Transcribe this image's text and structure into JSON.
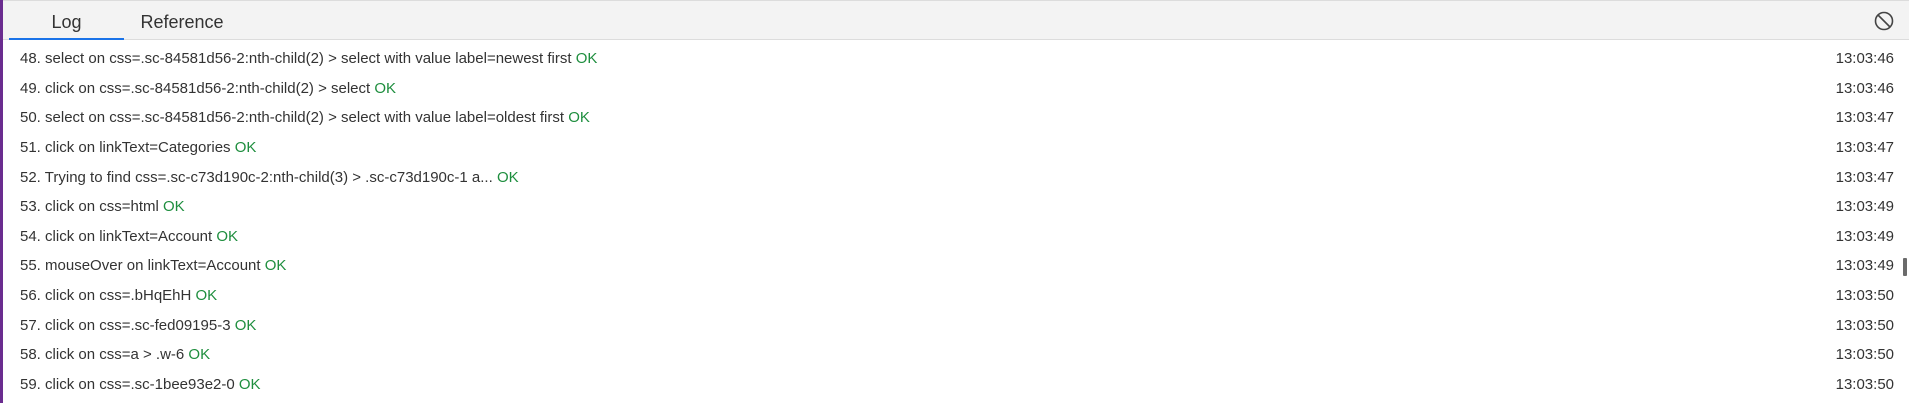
{
  "tabs": [
    {
      "label": "Log",
      "active": true
    },
    {
      "label": "Reference",
      "active": false
    }
  ],
  "toolbar": {
    "clear_icon": "no-entry-icon"
  },
  "colors": {
    "ok": "#1e8e3e",
    "accent": "#1a73e8",
    "window_border": "#6a2c8f"
  },
  "log": [
    {
      "num": "48.",
      "text": "select on css=.sc-84581d56-2:nth-child(2) > select with value label=newest first",
      "status": "OK",
      "time": "13:03:46"
    },
    {
      "num": "49.",
      "text": "click on css=.sc-84581d56-2:nth-child(2) > select",
      "status": "OK",
      "time": "13:03:46"
    },
    {
      "num": "50.",
      "text": "select on css=.sc-84581d56-2:nth-child(2) > select with value label=oldest first",
      "status": "OK",
      "time": "13:03:47"
    },
    {
      "num": "51.",
      "text": "click on linkText=Categories",
      "status": "OK",
      "time": "13:03:47"
    },
    {
      "num": "52.",
      "text": "Trying to find css=.sc-c73d190c-2:nth-child(3) > .sc-c73d190c-1 a...",
      "status": "OK",
      "time": "13:03:47"
    },
    {
      "num": "53.",
      "text": "click on css=html",
      "status": "OK",
      "time": "13:03:49"
    },
    {
      "num": "54.",
      "text": "click on linkText=Account",
      "status": "OK",
      "time": "13:03:49"
    },
    {
      "num": "55.",
      "text": "mouseOver on linkText=Account",
      "status": "OK",
      "time": "13:03:49"
    },
    {
      "num": "56.",
      "text": "click on css=.bHqEhH",
      "status": "OK",
      "time": "13:03:50"
    },
    {
      "num": "57.",
      "text": "click on css=.sc-fed09195-3",
      "status": "OK",
      "time": "13:03:50"
    },
    {
      "num": "58.",
      "text": "click on css=a > .w-6",
      "status": "OK",
      "time": "13:03:50"
    },
    {
      "num": "59.",
      "text": "click on css=.sc-1bee93e2-0",
      "status": "OK",
      "time": "13:03:50"
    }
  ]
}
